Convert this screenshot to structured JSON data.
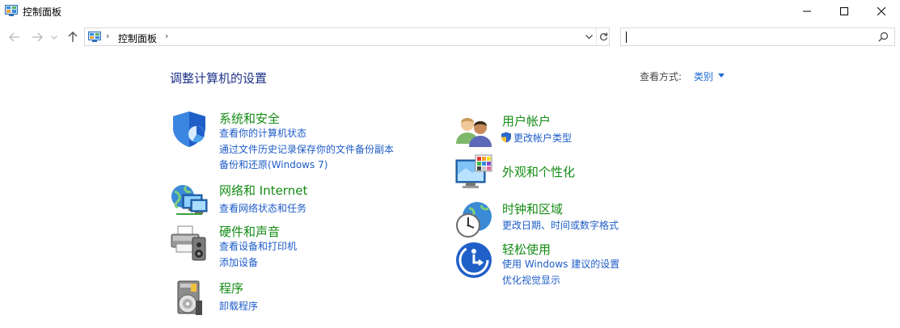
{
  "window": {
    "title": "控制面板",
    "controls": {
      "minimize": "minimize-icon",
      "maximize": "maximize-icon",
      "close": "close-icon"
    }
  },
  "nav": {
    "back": "back-arrow-icon",
    "forward": "forward-arrow-icon",
    "recent": "chevron-down-icon",
    "up": "up-arrow-icon"
  },
  "address": {
    "icon": "control-panel-icon",
    "separator": "›",
    "crumb": "控制面板"
  },
  "search": {
    "placeholder": "",
    "value": ""
  },
  "main": {
    "title": "调整计算机的设置",
    "view_by_label": "查看方式:",
    "view_by_value": "类别"
  },
  "categories_left": [
    {
      "heading": "系统和安全",
      "icon": "security-shield-icon",
      "links": [
        "查看你的计算机状态",
        "通过文件历史记录保存你的文件备份副本",
        "备份和还原(Windows 7)"
      ]
    },
    {
      "heading": "网络和 Internet",
      "icon": "network-globe-icon",
      "links": [
        "查看网络状态和任务"
      ]
    },
    {
      "heading": "硬件和声音",
      "icon": "printer-speaker-icon",
      "links": [
        "查看设备和打印机",
        "添加设备"
      ]
    },
    {
      "heading": "程序",
      "icon": "programs-disc-icon",
      "links": [
        "卸载程序"
      ]
    }
  ],
  "categories_right": [
    {
      "heading": "用户帐户",
      "icon": "users-icon",
      "links": [
        "更改帐户类型"
      ],
      "link_icon": "uac-shield-icon"
    },
    {
      "heading": "外观和个性化",
      "icon": "monitor-palette-icon",
      "links": []
    },
    {
      "heading": "时钟和区域",
      "icon": "clock-globe-icon",
      "links": [
        "更改日期、时间或数字格式"
      ]
    },
    {
      "heading": "轻松使用",
      "icon": "ease-of-access-icon",
      "links": [
        "使用 Windows 建议的设置",
        "优化视觉显示"
      ]
    }
  ],
  "colors": {
    "heading_green": "#148c14",
    "link_blue": "#1e5cc8",
    "title_blue": "#1e3287"
  }
}
